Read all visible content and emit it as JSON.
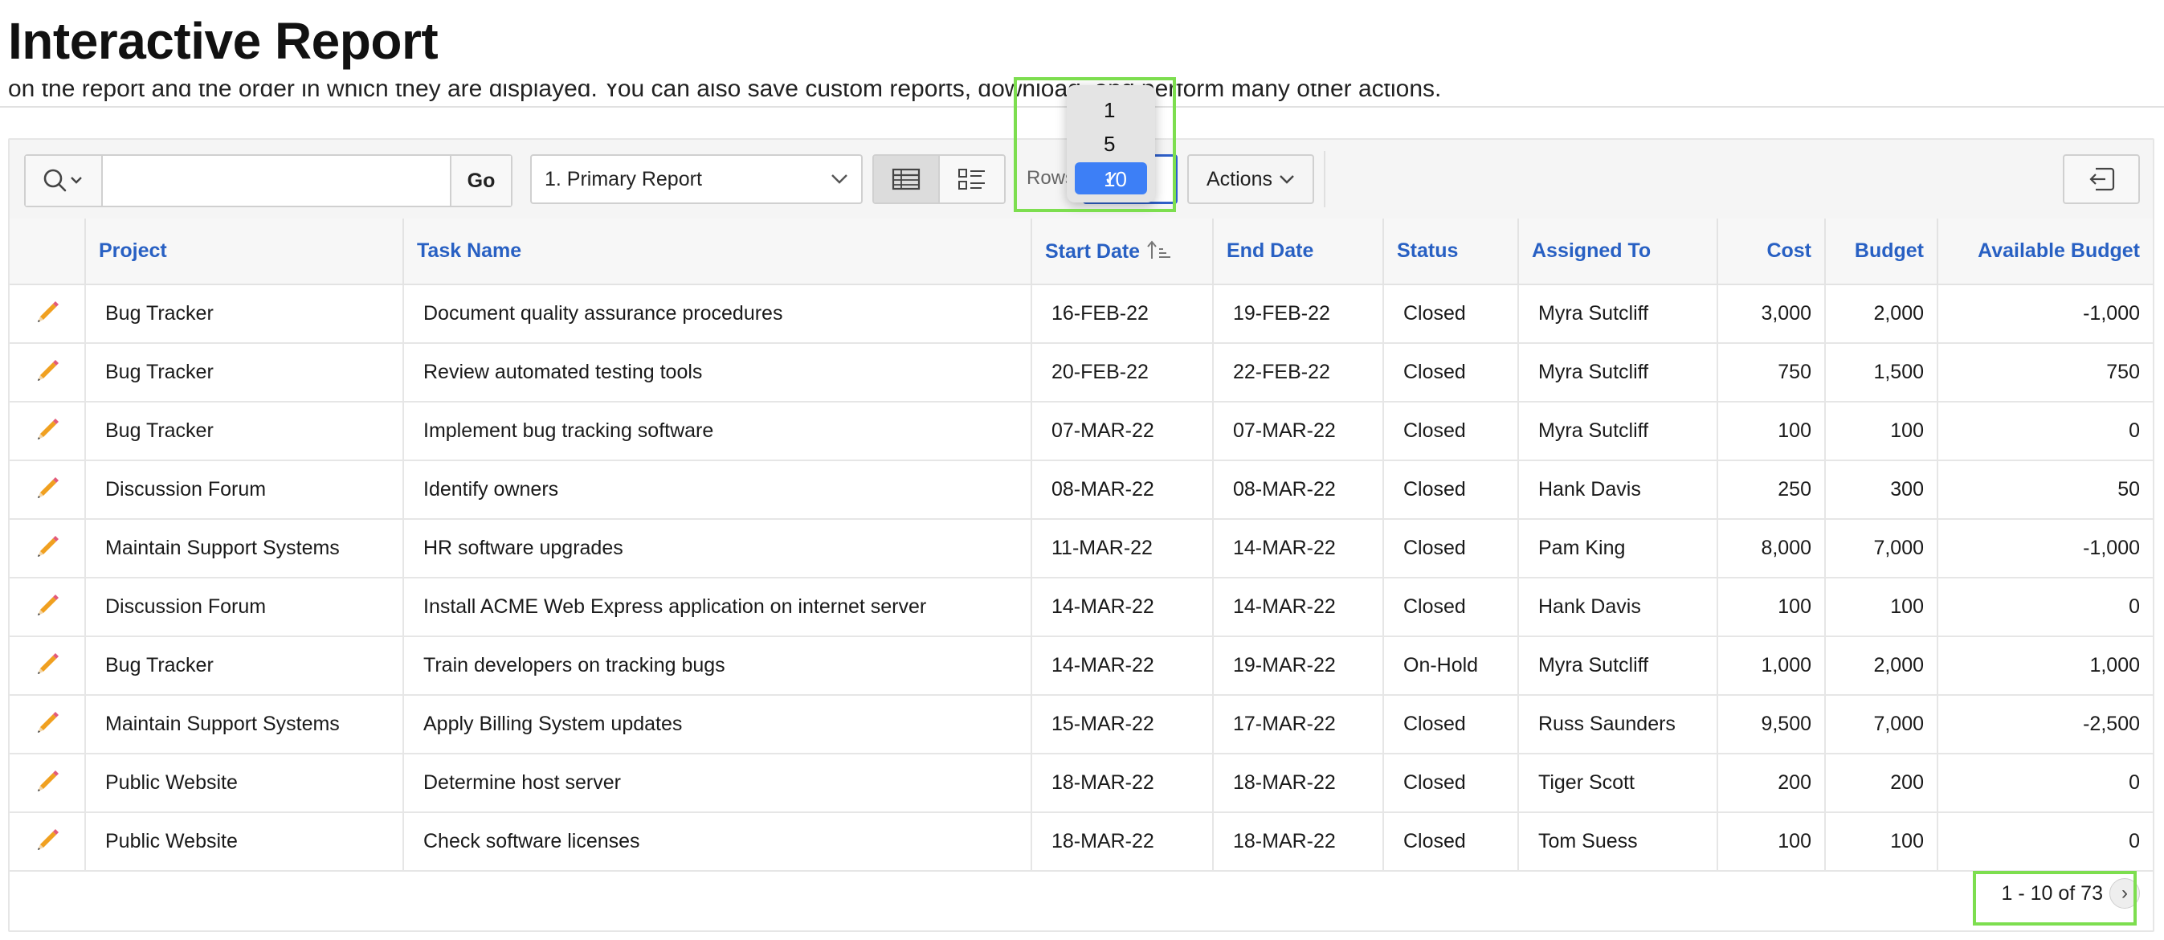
{
  "page": {
    "title": "Interactive Report",
    "subtitle": "on the report and the order in which they are displayed. You can also save custom reports, download, and perform many other actions."
  },
  "toolbar": {
    "search_placeholder": "",
    "go_label": "Go",
    "report_select_value": "1. Primary Report",
    "rows_label": "Rows",
    "actions_label": "Actions"
  },
  "rows_dropdown": {
    "options": [
      "1",
      "5",
      "10"
    ],
    "selected": "10",
    "check_mark": "✓"
  },
  "table": {
    "columns": [
      "",
      "Project",
      "Task Name",
      "Start Date",
      "End Date",
      "Status",
      "Assigned To",
      "Cost",
      "Budget",
      "Available Budget"
    ],
    "rows": [
      [
        "Bug Tracker",
        "Document quality assurance procedures",
        "16-FEB-22",
        "19-FEB-22",
        "Closed",
        "Myra Sutcliff",
        "3,000",
        "2,000",
        "-1,000"
      ],
      [
        "Bug Tracker",
        "Review automated testing tools",
        "20-FEB-22",
        "22-FEB-22",
        "Closed",
        "Myra Sutcliff",
        "750",
        "1,500",
        "750"
      ],
      [
        "Bug Tracker",
        "Implement bug tracking software",
        "07-MAR-22",
        "07-MAR-22",
        "Closed",
        "Myra Sutcliff",
        "100",
        "100",
        "0"
      ],
      [
        "Discussion Forum",
        "Identify owners",
        "08-MAR-22",
        "08-MAR-22",
        "Closed",
        "Hank Davis",
        "250",
        "300",
        "50"
      ],
      [
        "Maintain Support Systems",
        "HR software upgrades",
        "11-MAR-22",
        "14-MAR-22",
        "Closed",
        "Pam King",
        "8,000",
        "7,000",
        "-1,000"
      ],
      [
        "Discussion Forum",
        "Install ACME Web Express application on internet server",
        "14-MAR-22",
        "14-MAR-22",
        "Closed",
        "Hank Davis",
        "100",
        "100",
        "0"
      ],
      [
        "Bug Tracker",
        "Train developers on tracking bugs",
        "14-MAR-22",
        "19-MAR-22",
        "On-Hold",
        "Myra Sutcliff",
        "1,000",
        "2,000",
        "1,000"
      ],
      [
        "Maintain Support Systems",
        "Apply Billing System updates",
        "15-MAR-22",
        "17-MAR-22",
        "Closed",
        "Russ Saunders",
        "9,500",
        "7,000",
        "-2,500"
      ],
      [
        "Public Website",
        "Determine host server",
        "18-MAR-22",
        "18-MAR-22",
        "Closed",
        "Tiger Scott",
        "200",
        "200",
        "0"
      ],
      [
        "Public Website",
        "Check software licenses",
        "18-MAR-22",
        "18-MAR-22",
        "Closed",
        "Tom Suess",
        "100",
        "100",
        "0"
      ]
    ]
  },
  "pagination": {
    "range_text": "1 - 10 of 73",
    "next_symbol": "›"
  },
  "colors": {
    "header_text": "#2860c3",
    "highlight": "#7dde4f",
    "selected_option": "#3d7ff6",
    "edit_icon": "#f0a020"
  }
}
